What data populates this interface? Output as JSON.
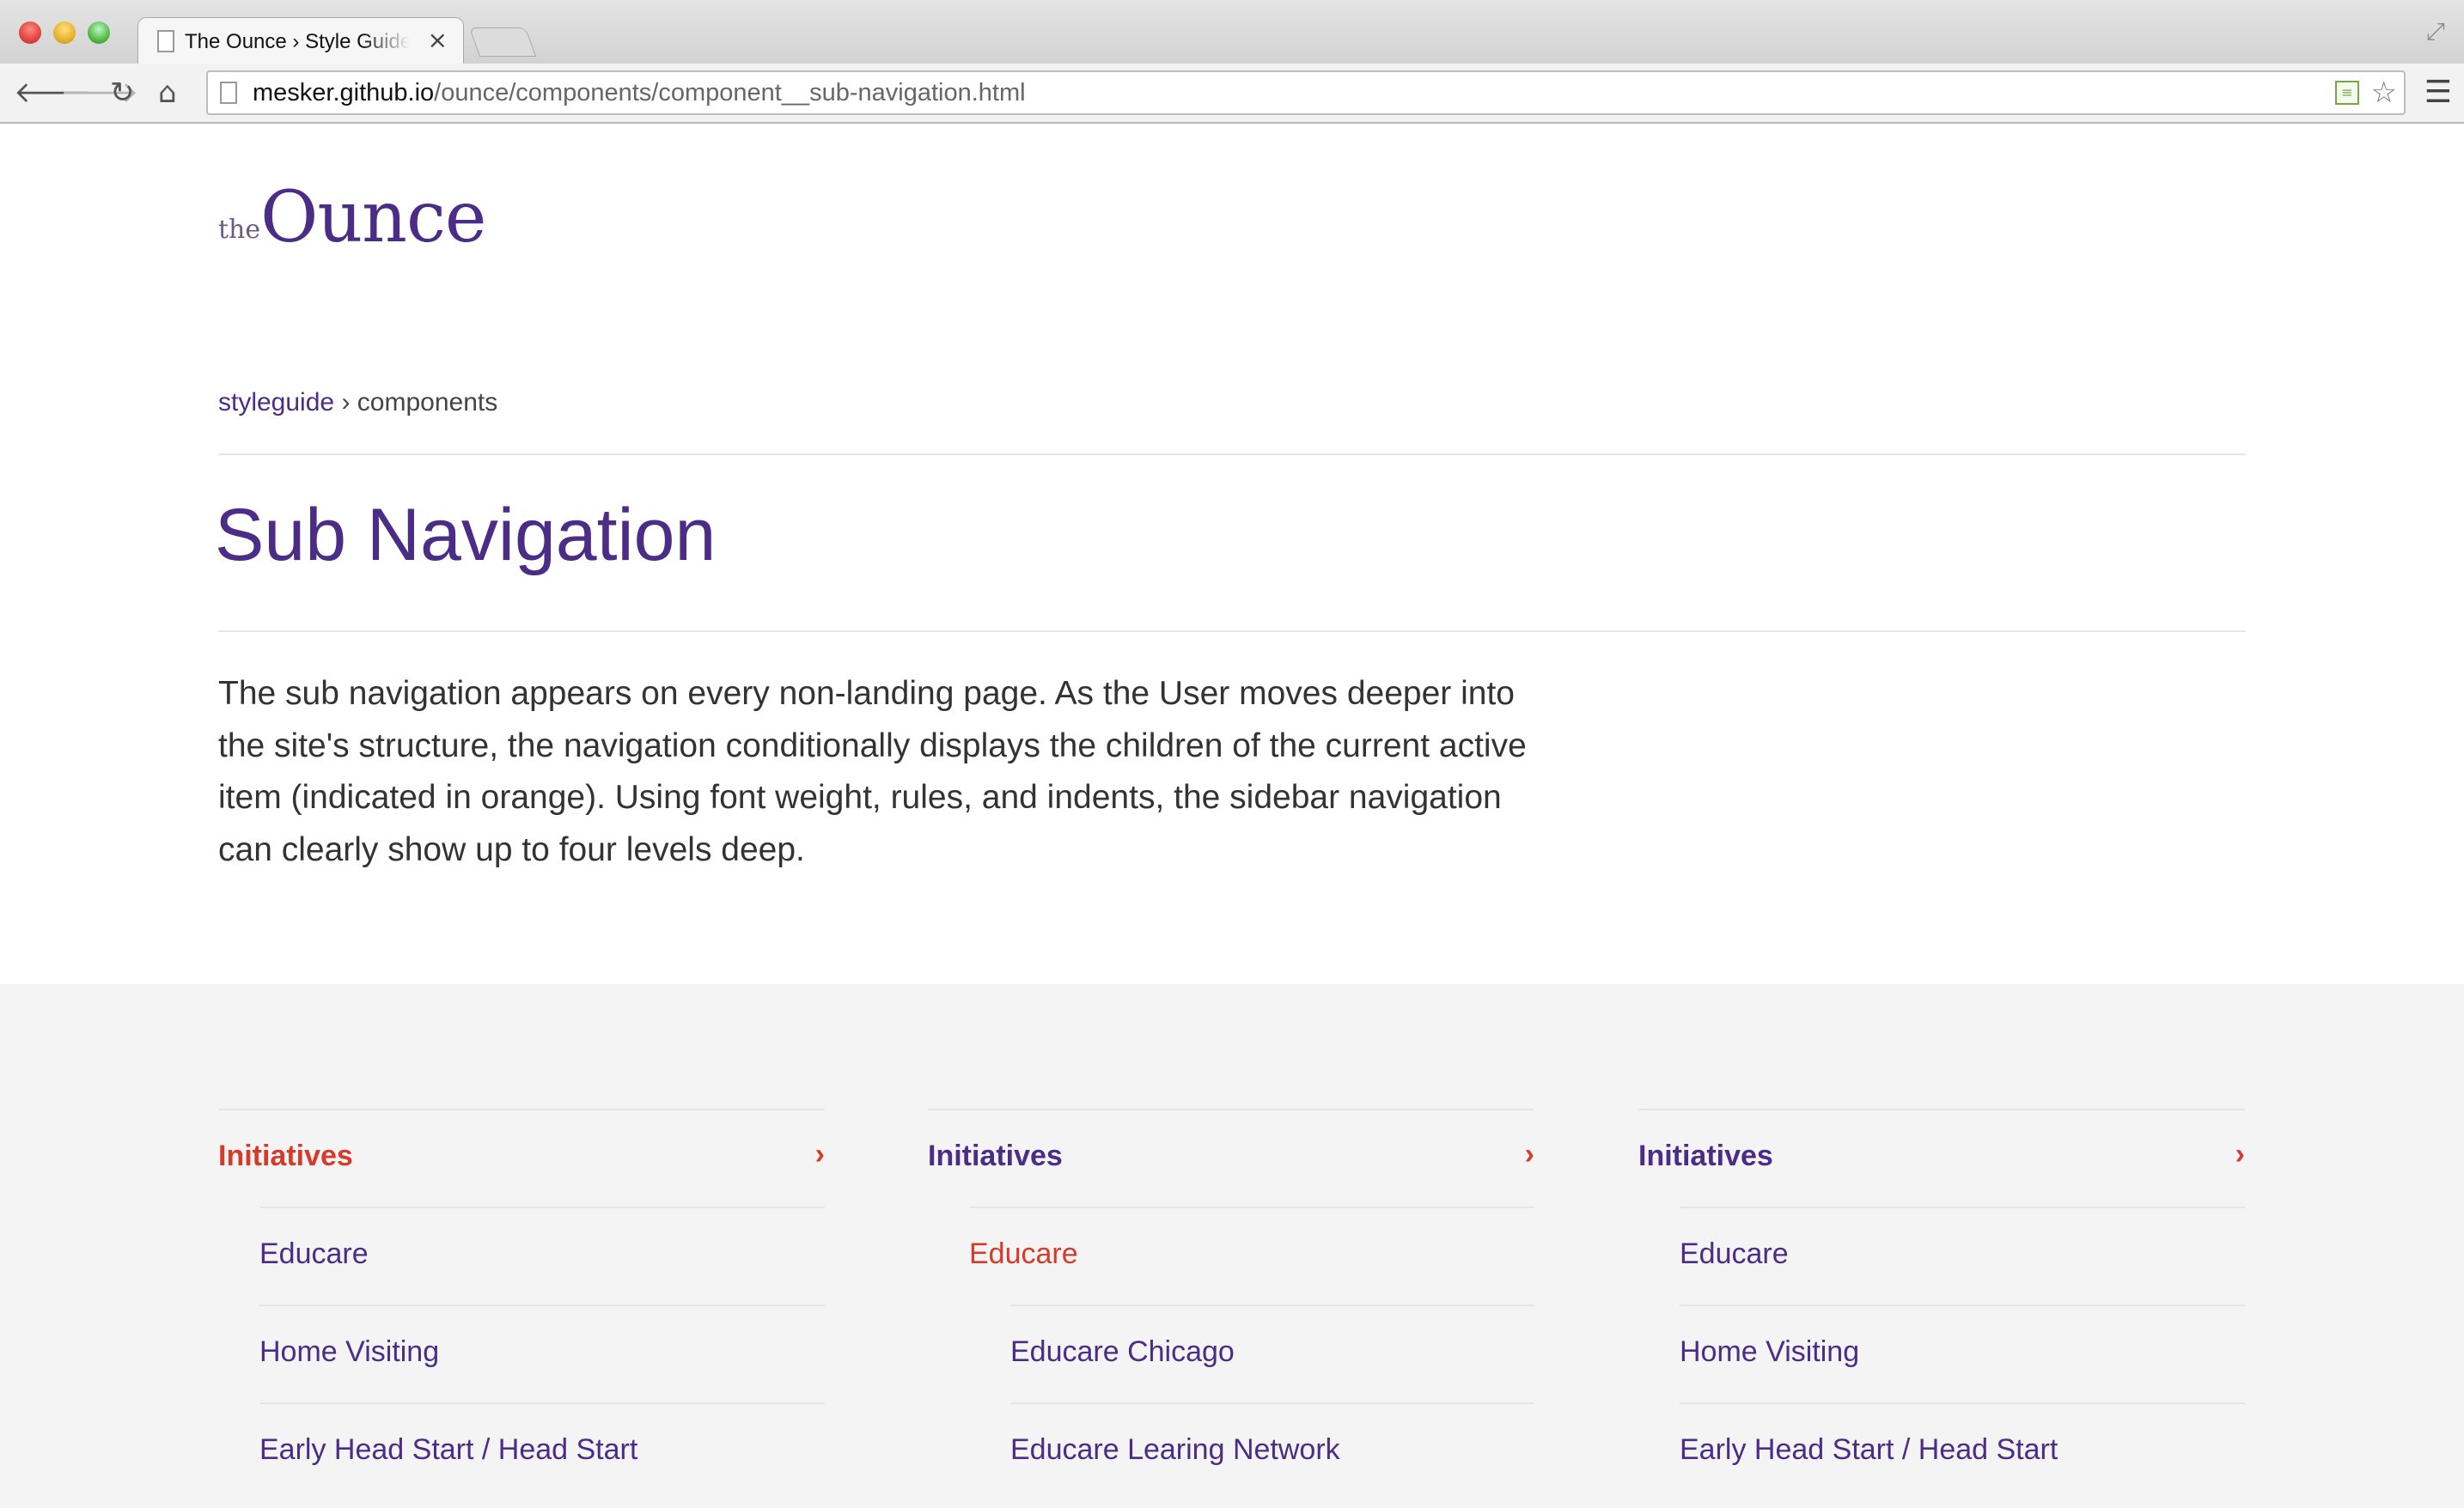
{
  "browser": {
    "tab_title": "The Ounce › Style Guide : S",
    "url_host": "mesker.github.io",
    "url_path": "/ounce/components/component__sub-navigation.html"
  },
  "logo": {
    "the": "the",
    "name": "Ounce"
  },
  "breadcrumb": {
    "link": "styleguide",
    "separator": "›",
    "current": "components"
  },
  "page_title": "Sub Navigation",
  "intro": "The sub navigation appears on every non-landing page. As the User moves deeper into the site's structure, the navigation conditionally displays the children of the current active item (indicated in orange). Using font weight, rules, and indents, the sidebar navigation can clearly show up to four levels deep.",
  "colors": {
    "brand_purple": "#4b2c86",
    "active_orange": "#d63a2b",
    "demo_bg": "#f4f4f4"
  },
  "examples": [
    {
      "items": [
        {
          "label": "Initiatives",
          "level": 1,
          "active": true
        },
        {
          "label": "Educare",
          "level": 2,
          "active": false
        },
        {
          "label": "Home Visiting",
          "level": 2,
          "active": false
        },
        {
          "label": "Early Head Start / Head Start",
          "level": 2,
          "active": false
        }
      ]
    },
    {
      "items": [
        {
          "label": "Initiatives",
          "level": 1,
          "active": false
        },
        {
          "label": "Educare",
          "level": 2,
          "active": true
        },
        {
          "label": "Educare Chicago",
          "level": 3,
          "active": false
        },
        {
          "label": "Educare Learing Network",
          "level": 3,
          "active": false
        }
      ]
    },
    {
      "items": [
        {
          "label": "Initiatives",
          "level": 1,
          "active": false
        },
        {
          "label": "Educare",
          "level": 2,
          "active": false
        },
        {
          "label": "Home Visiting",
          "level": 2,
          "active": false
        },
        {
          "label": "Early Head Start / Head Start",
          "level": 2,
          "active": false
        }
      ]
    }
  ],
  "chevron": "›"
}
